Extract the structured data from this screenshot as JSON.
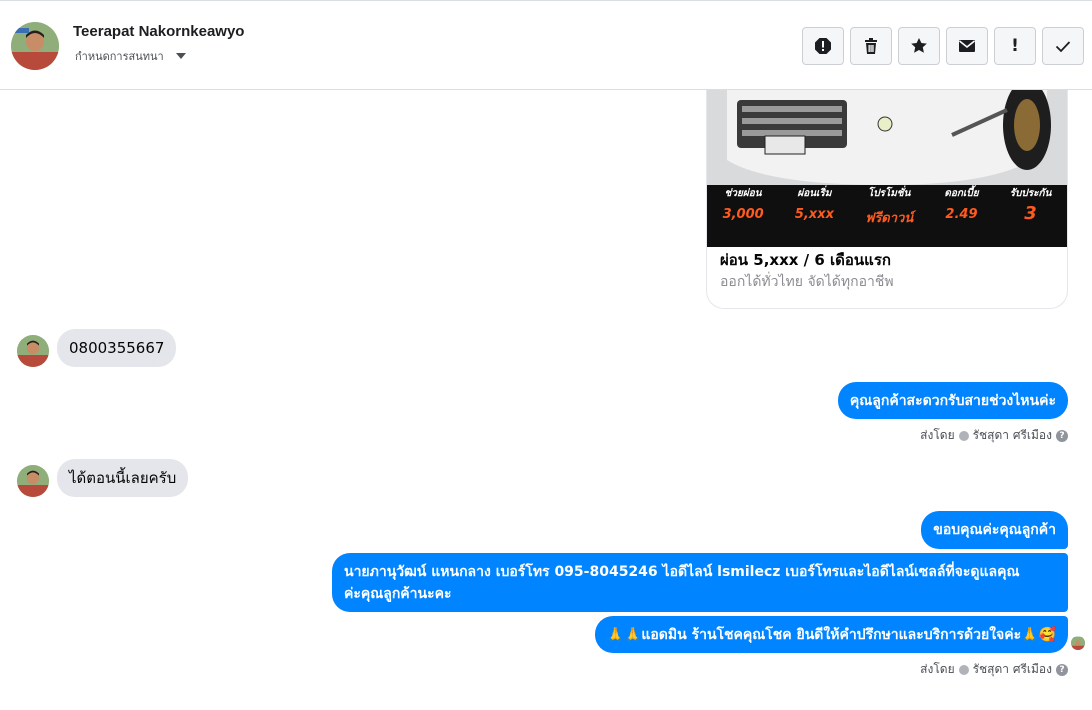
{
  "header": {
    "contact_name": "Teerapat Nakornkeawyo",
    "subtitle": "กำหนดการสนทนา"
  },
  "toolbar": {
    "buttons": [
      {
        "icon": "report-icon"
      },
      {
        "icon": "trash-icon"
      },
      {
        "icon": "star-icon"
      },
      {
        "icon": "envelope-icon"
      },
      {
        "icon": "exclamation-icon",
        "label": "!"
      },
      {
        "icon": "check-icon"
      }
    ]
  },
  "promo_card": {
    "banner_labels": [
      "ช่วยผ่อน",
      "ผ่อนเริ่ม",
      "โปรโมชั่น",
      "ดอกเบี้ย",
      "รับประกัน"
    ],
    "banner_values": [
      "3,000",
      "5,xxx",
      "ฟรีดาวน์",
      "2.49",
      "3"
    ],
    "title": "ผ่อน 5,xxx / 6 เดือนแรก",
    "subtitle": "ออกได้ทั่วไทย จัดได้ทุกอาชีพ"
  },
  "messages": [
    {
      "dir": "in",
      "text": "0800355667"
    },
    {
      "dir": "out",
      "text": "คุณลูกค้าสะดวกรับสายช่วงไหนค่ะ"
    },
    {
      "dir": "in",
      "text": "ได้ตอนนี้เลยครับ"
    },
    {
      "dir": "out",
      "text": "ขอบคุณค่ะคุณลูกค้า"
    },
    {
      "dir": "out",
      "text_line1": "นายภานุวัฒน์ แหนกลาง เบอร์โทร 095-8045246 ไอดีไลน์ lsmilecz   เบอร์โทรและไอดีไลน์เซลล์ที่จะดูแลคุณ",
      "text_line2": "ค่ะคุณลูกค้านะคะ"
    },
    {
      "dir": "out",
      "text": "🙏🙏แอดมิน ร้านโชคคุณโชค ยินดีให้คำปรึกษาและบริการด้วยใจค่ะ🙏🥰"
    }
  ],
  "sent_by": {
    "prefix": "ส่งโดย",
    "agent": "รัชสุดา ศรีเมือง",
    "help": "?"
  },
  "colors": {
    "outgoing_bubble": "#0084ff",
    "incoming_bubble": "#e4e6eb"
  }
}
